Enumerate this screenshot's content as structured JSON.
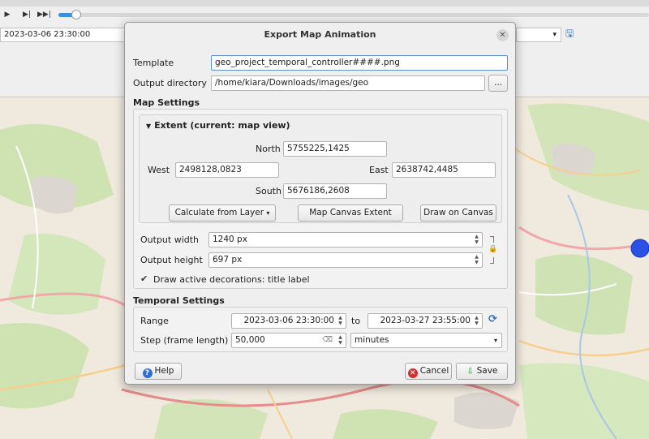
{
  "timeline": {
    "progress_fraction": 0.03,
    "current_datetime": "2023-03-06 23:30:00"
  },
  "icons": {
    "play": "play-icon",
    "step_forward": "step-forward-icon",
    "skip_end": "skip-end-icon",
    "save": "save-icon",
    "close": "close-icon",
    "refresh": "refresh-icon",
    "lock": "lock-icon",
    "help": "help-icon",
    "cancel": "cancel-icon",
    "export": "save-icon"
  },
  "colors": {
    "accent": "#3d8ee0",
    "map_marker": "#2b50e6",
    "cancel": "#d43030",
    "help": "#2f6fd0"
  },
  "dialog": {
    "title": "Export Map Animation",
    "template_label": "Template",
    "template_value": "geo_project_temporal_controller####.png",
    "output_dir_label": "Output directory",
    "output_dir_value": "/home/kiara/Downloads/images/geo",
    "browse_label": "...",
    "map_settings": {
      "title": "Map Settings",
      "extent_title": "Extent (current: map view)",
      "north_label": "North",
      "north_value": "5755225,1425",
      "west_label": "West",
      "west_value": "2498128,0823",
      "east_label": "East",
      "east_value": "2638742,4485",
      "south_label": "South",
      "south_value": "5676186,2608",
      "calc_from_layer": "Calculate from Layer",
      "map_canvas_extent": "Map Canvas Extent",
      "draw_on_canvas": "Draw on Canvas",
      "output_width_label": "Output width",
      "output_width_value": "1240 px",
      "output_height_label": "Output height",
      "output_height_value": "697 px",
      "decorations_label": "Draw active decorations: title label",
      "decorations_checked": "✔"
    },
    "temporal_settings": {
      "title": "Temporal Settings",
      "range_label": "Range",
      "range_start": "2023-03-06 23:30:00",
      "range_to": "to",
      "range_end": "2023-03-27 23:55:00",
      "step_label": "Step (frame length)",
      "step_value": "50,000",
      "step_unit": "minutes"
    },
    "buttons": {
      "help": "Help",
      "cancel": "Cancel",
      "save": "Save"
    }
  }
}
